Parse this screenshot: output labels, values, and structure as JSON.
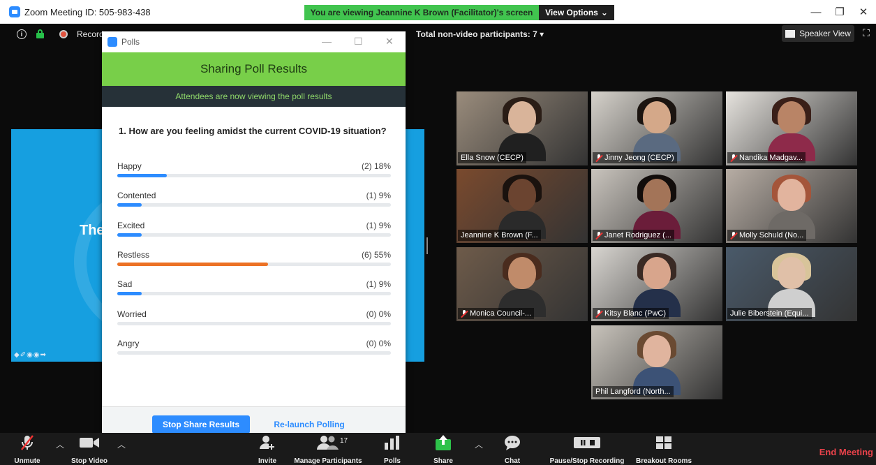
{
  "window": {
    "title": "Zoom Meeting ID: 505-983-438",
    "viewing_banner": "You are viewing Jeannine K Brown (Facilitator)'s screen",
    "view_options": "View Options"
  },
  "top_info": {
    "record_label": "Record",
    "non_video": "Total non-video participants: 7",
    "speaker_view": "Speaker View"
  },
  "shared_slide": {
    "visible_text": "The"
  },
  "poll": {
    "window_title": "Polls",
    "heading": "Sharing Poll Results",
    "subheading": "Attendees are now viewing the poll results",
    "question": "1. How are you feeling amidst the current COVID-19 situation?",
    "answers": [
      {
        "label": "Happy",
        "result": "(2) 18%",
        "percent": 18
      },
      {
        "label": "Contented",
        "result": "(1) 9%",
        "percent": 9
      },
      {
        "label": "Excited",
        "result": "(1) 9%",
        "percent": 9
      },
      {
        "label": "Restless",
        "result": "(6) 55%",
        "percent": 55
      },
      {
        "label": "Sad",
        "result": "(1) 9%",
        "percent": 9
      },
      {
        "label": "Worried",
        "result": "(0) 0%",
        "percent": 0
      },
      {
        "label": "Angry",
        "result": "(0) 0%",
        "percent": 0
      }
    ],
    "stop_share": "Stop Share Results",
    "relaunch": "Re-launch Polling",
    "highlight_color": "#ec7225",
    "bar_color": "#2d8cff"
  },
  "participants": [
    {
      "name": "Ella Snow (CECP)",
      "muted": false
    },
    {
      "name": "Jinny Jeong (CECP)",
      "muted": true
    },
    {
      "name": "Nandika Madgav...",
      "muted": true
    },
    {
      "name": "Jeannine K Brown (F...",
      "muted": false
    },
    {
      "name": "Janet Rodriguez (...",
      "muted": true
    },
    {
      "name": "Molly Schuld (No...",
      "muted": true
    },
    {
      "name": "Monica Council-...",
      "muted": true
    },
    {
      "name": "Kitsy Blanc (PwC)",
      "muted": true
    },
    {
      "name": "Julie Biberstein (Equi...",
      "muted": false
    },
    {
      "name": "Phil Langford (North...",
      "muted": false
    }
  ],
  "toolbar": {
    "unmute": "Unmute",
    "stop_video": "Stop Video",
    "invite": "Invite",
    "manage_participants": "Manage Participants",
    "participant_count": "17",
    "polls": "Polls",
    "share": "Share",
    "chat": "Chat",
    "pause_recording": "Pause/Stop Recording",
    "breakout_rooms": "Breakout Rooms",
    "end_meeting": "End Meeting"
  }
}
